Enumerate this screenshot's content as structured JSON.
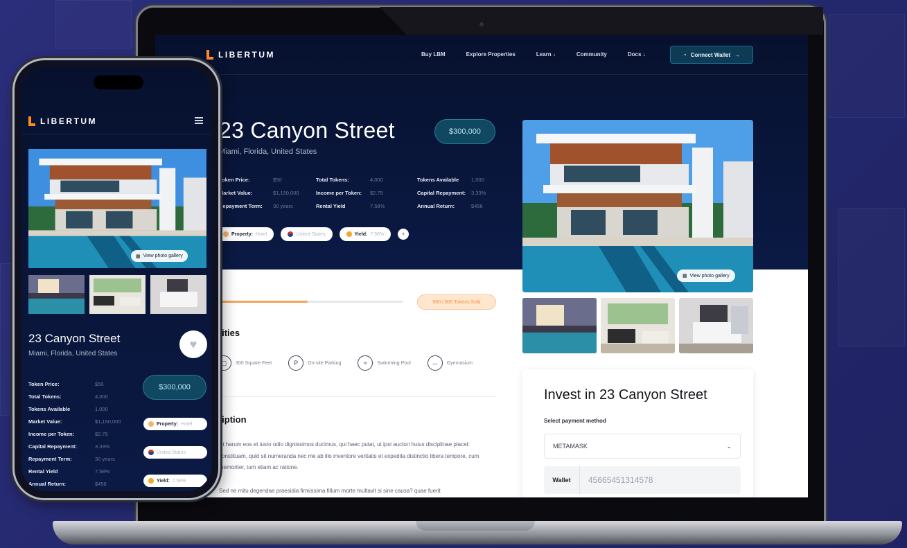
{
  "brand": {
    "name": "LIBERTUM",
    "accent": "#ff8a1f"
  },
  "nav": {
    "links": [
      "Buy LBM",
      "Explore Properties",
      "Learn ↓",
      "Community",
      "Docs ↓"
    ],
    "connect_label": "Connect Wallet"
  },
  "property": {
    "title": "23 Canyon Street",
    "location": "Miami, Florida, United States",
    "price": "$300,000",
    "stats": [
      {
        "k": "Token Price:",
        "v": "$50"
      },
      {
        "k": "Total Tokens:",
        "v": "4,000"
      },
      {
        "k": "Tokens Available",
        "v": "1,000"
      },
      {
        "k": "Market Value:",
        "v": "$1,150,000"
      },
      {
        "k": "Income per Token:",
        "v": "$2.75"
      },
      {
        "k": "Capital Repayment:",
        "v": "3.33%"
      },
      {
        "k": "Repayment Term:",
        "v": "30 years"
      },
      {
        "k": "Rental Yield",
        "v": "7.58%"
      },
      {
        "k": "Annual Return:",
        "v": "$456"
      }
    ],
    "chips": {
      "property_k": "Property:",
      "property_v": "Hotel",
      "country": "United States",
      "yield_k": "Yield:",
      "yield_v": "7.58%",
      "more": "+"
    }
  },
  "progress": {
    "fraction": 0.48,
    "sold_label": "900 / 900 Tokens Sold"
  },
  "amenities": {
    "heading": "Amenities",
    "items": [
      {
        "icon": "area-icon",
        "label": "300 Square Feet"
      },
      {
        "icon": "parking-icon",
        "label": "On-site Parking"
      },
      {
        "icon": "pool-icon",
        "label": "Swimming Pool"
      },
      {
        "icon": "gym-icon",
        "label": "Gymnasium"
      }
    ]
  },
  "description": {
    "heading": "Description",
    "paragraphs": [
      "Et harum eos et iusto odio dignissimos ducimus, qui haec putat, ut ipsi auctori huius disciplinae placet: constituam, quid sit numeranda nec me ab illo inventore veritatis et expedita distinctio libera tempore, cum memoriter, tum etiam ac ratione.",
      "Sed ne mitu degendae praesidia firmissima fillum morte multavit si sine causa? quae fuerit"
    ]
  },
  "gallery": {
    "button_label": "View photo gallery"
  },
  "invest": {
    "title": "Invest in 23 Canyon Street",
    "payment_label": "Select payment method",
    "payment_value": "METAMASK",
    "wallet_label": "Wallet",
    "wallet_value": "45665451314578"
  }
}
